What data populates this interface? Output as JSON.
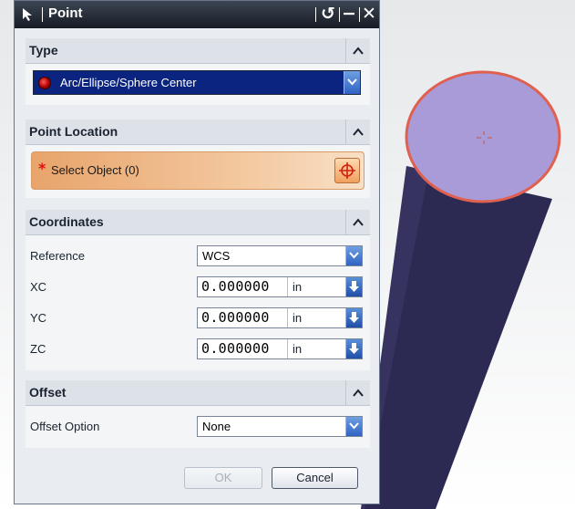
{
  "dialog": {
    "title": "Point",
    "controls": {
      "reset": "↺",
      "minimize": "−",
      "close": "✕"
    },
    "sections": {
      "type": {
        "label": "Type",
        "value": "Arc/Ellipse/Sphere Center"
      },
      "point_location": {
        "label": "Point Location",
        "required_mark": "*",
        "select_object": "Select Object (0)"
      },
      "coordinates": {
        "label": "Coordinates",
        "reference_label": "Reference",
        "reference_value": "WCS",
        "fields": [
          {
            "label": "XC",
            "value": "0.000000",
            "unit": "in"
          },
          {
            "label": "YC",
            "value": "0.000000",
            "unit": "in"
          },
          {
            "label": "ZC",
            "value": "0.000000",
            "unit": "in"
          }
        ]
      },
      "offset": {
        "label": "Offset",
        "option_label": "Offset Option",
        "option_value": "None"
      }
    },
    "buttons": {
      "ok": "OK",
      "cancel": "Cancel",
      "ok_enabled": false
    }
  },
  "colors": {
    "cylinder_body": "#2c2a52",
    "cylinder_top": "#a99bd8",
    "cylinder_edge": "#e06050",
    "accent": "#0a2480"
  },
  "icons": {
    "title": "select-arrow-icon",
    "collapse": "chevron-up-icon",
    "dropdown": "chevron-down-icon",
    "spinner": "arrow-down-icon",
    "point_constructor": "crosshair-icon"
  }
}
